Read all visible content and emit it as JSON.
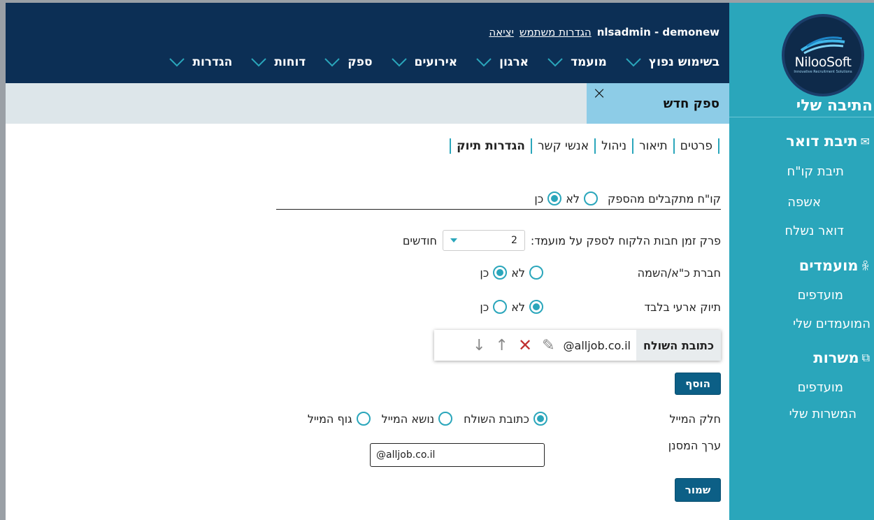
{
  "sidebar": {
    "logo": {
      "brand": "NilooSoft",
      "tagline": "Innovative Recruitment Solutions"
    },
    "title": "התיבה שלי",
    "mail": {
      "label": "תיבת דואר",
      "items": [
        "תיבת קו\"ח",
        "אשפה",
        "דואר נשלח"
      ]
    },
    "candidates": {
      "label": "מועמדים",
      "items": [
        "מועדפים",
        "המועמדים שלי"
      ]
    },
    "jobs": {
      "label": "משרות",
      "items": [
        "מועדפים",
        "המשרות שלי"
      ]
    }
  },
  "header": {
    "user": "nlsadmin - demonew",
    "settings_link": "הגדרות משתמש",
    "logout_link": "יציאה",
    "nav": [
      "בשימוש נפוץ",
      "מועמד",
      "ארגון",
      "אירועים",
      "ספק",
      "דוחות",
      "הגדרות"
    ]
  },
  "tab": {
    "title": "ספק חדש",
    "close": "×"
  },
  "subtabs": [
    "פרטים",
    "תיאור",
    "ניהול",
    "אנשי קשר",
    "הגדרות תיוק"
  ],
  "form": {
    "cv_from_supplier": {
      "label": "קו\"ח מתקבלים מהספק",
      "no": "לא",
      "yes": "כן"
    },
    "period": {
      "label": "פרק זמן חבות הלקוח לספק על מועמד:",
      "value": "2",
      "unit": "חודשים"
    },
    "placement_company": {
      "label": "חברת כ\"א/השמה",
      "no": "לא",
      "yes": "כן"
    },
    "temp_filing": {
      "label": "תיוק ארעי בלבד",
      "no": "לא",
      "yes": "כן"
    },
    "sender_row": {
      "header": "כתובת השולח",
      "value": "@alljob.co.il"
    },
    "add_button": "הוסף",
    "mail_part": {
      "label": "חלק המייל",
      "options": [
        "כתובת השולח",
        "נושא המייל",
        "גוף המייל"
      ]
    },
    "filter_value": {
      "label": "ערך המסנן",
      "value": "@alljob.co.il"
    },
    "save_button": "שמור"
  },
  "colors": {
    "sidebar": "#2aa6bb",
    "topbar": "#0c2f55",
    "accent": "#2aa6bb",
    "button": "#0c5f86"
  }
}
